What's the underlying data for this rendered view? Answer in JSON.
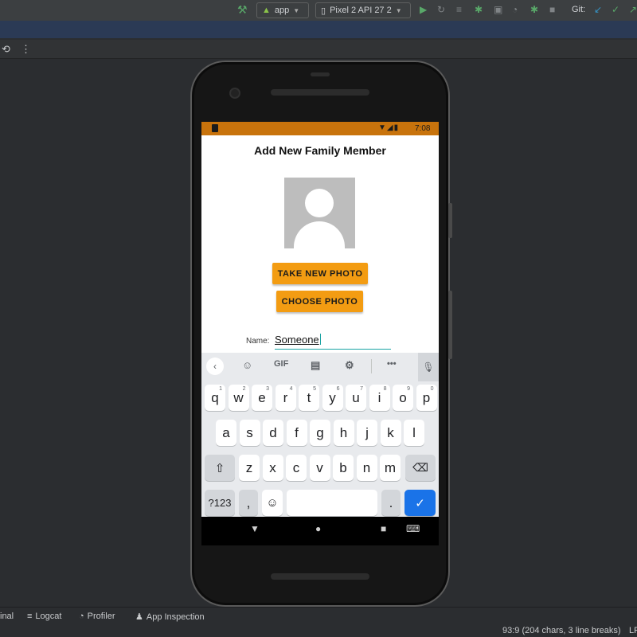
{
  "ide": {
    "run_config": "app",
    "device": "Pixel 2 API 27 2",
    "git_label": "Git:",
    "bottom_tabs": [
      {
        "label": "inal"
      },
      {
        "label": "Logcat"
      },
      {
        "label": "Profiler"
      },
      {
        "label": "App Inspection"
      }
    ],
    "status_position": "93:9 (204 chars, 3 line breaks)",
    "line_separator": "LF"
  },
  "phone": {
    "status_time": "7:08",
    "screen_title": "Add New Family Member",
    "take_photo_label": "TAKE NEW PHOTO",
    "choose_photo_label": "CHOOSE PHOTO",
    "name_label": "Name:",
    "name_value": "Someone"
  },
  "keyboard": {
    "toolbar": {
      "gif": "GIF",
      "more": "•••"
    },
    "row1": [
      {
        "k": "q",
        "h": "1"
      },
      {
        "k": "w",
        "h": "2"
      },
      {
        "k": "e",
        "h": "3"
      },
      {
        "k": "r",
        "h": "4"
      },
      {
        "k": "t",
        "h": "5"
      },
      {
        "k": "y",
        "h": "6"
      },
      {
        "k": "u",
        "h": "7"
      },
      {
        "k": "i",
        "h": "8"
      },
      {
        "k": "o",
        "h": "9"
      },
      {
        "k": "p",
        "h": "0"
      }
    ],
    "row2": [
      "a",
      "s",
      "d",
      "f",
      "g",
      "h",
      "j",
      "k",
      "l"
    ],
    "row3": [
      "z",
      "x",
      "c",
      "v",
      "b",
      "n",
      "m"
    ],
    "symbols_label": "?123",
    "comma_label": ",",
    "period_label": "."
  },
  "colors": {
    "accent": "#f39c12",
    "status_bar": "#c8730c",
    "input_underline": "#19a3a3",
    "enter_key": "#1a73e8"
  }
}
